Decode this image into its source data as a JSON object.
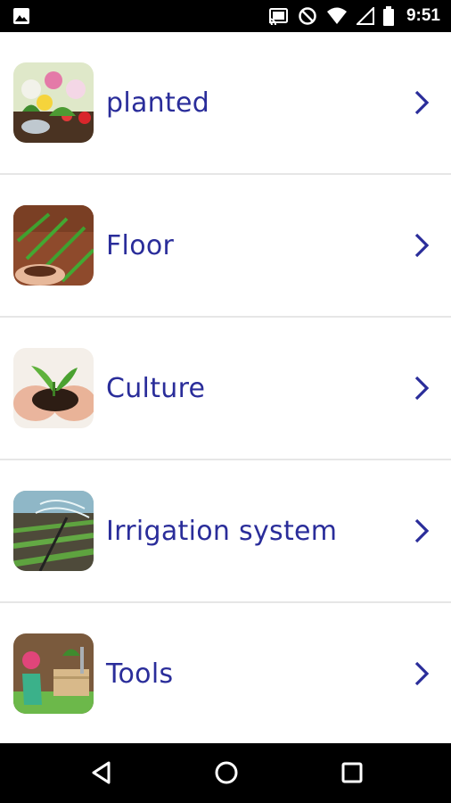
{
  "status_bar": {
    "time": "9:51",
    "icons": [
      "image-notification-icon",
      "cast-icon",
      "do-not-disturb-icon",
      "wifi-icon",
      "signal-icon",
      "battery-icon"
    ]
  },
  "menu": {
    "items": [
      {
        "label": "planted",
        "icon": "planted-thumbnail"
      },
      {
        "label": "Floor",
        "icon": "floor-thumbnail"
      },
      {
        "label": "Culture",
        "icon": "culture-thumbnail"
      },
      {
        "label": "Irrigation system",
        "icon": "irrigation-thumbnail"
      },
      {
        "label": "Tools",
        "icon": "tools-thumbnail"
      }
    ]
  },
  "nav_bar": {
    "buttons": [
      "back-icon",
      "home-icon",
      "recents-icon"
    ]
  },
  "colors": {
    "label": "#2a2d9a",
    "chevron": "#2a2d9a",
    "divider": "#e6e6e6",
    "bars": "#000000"
  }
}
